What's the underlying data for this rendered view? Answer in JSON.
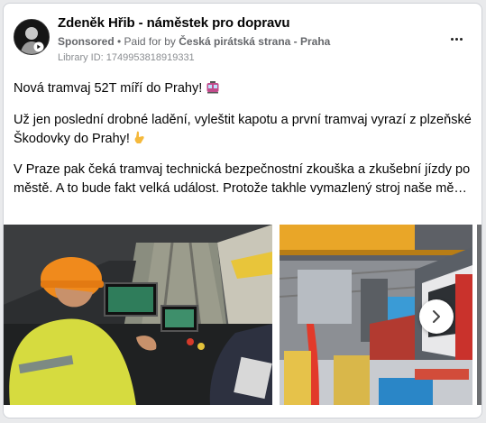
{
  "post": {
    "page_name": "Zdeněk Hřib - náměstek pro dopravu",
    "sponsored_label": "Sponsored",
    "separator": " • ",
    "paid_for_label": "Paid for by ",
    "payer": "Česká pirátská strana - Praha",
    "library_id": "Library ID: 1749953818919331",
    "text": {
      "line1": "Nová tramvaj 52T míří do Prahy!",
      "line2": "Už jen poslední drobné ladění, vyleštit kapotu a první tramvaj vyrazí z plzeňské Škodovky do Prahy!",
      "line3a": "V Praze pak čeká tramvaj technická bezpečnostní zkouška a zkušební jízdy po",
      "line3b": "městě. A to bude fakt velká událost. Protože takhle vymazlený stroj naše město…"
    }
  },
  "media": {
    "images": [
      {
        "name": "tram-driver-cab-photo"
      },
      {
        "name": "factory-hall-tram-photo"
      },
      {
        "name": "third-photo-peek"
      }
    ],
    "next_icon": "chevron-right-icon"
  },
  "icons": {
    "more": "more-horizontal-icon",
    "tram_emoji": "tram-emoji-icon",
    "hand_emoji": "hand-emoji-icon"
  },
  "colors": {
    "text_primary": "#050505",
    "text_secondary": "#65676b",
    "card_bg": "#ffffff",
    "page_bg": "#e9eaec"
  }
}
